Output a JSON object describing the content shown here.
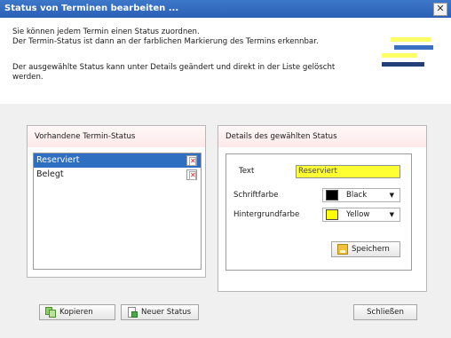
{
  "window": {
    "title": "Status von Terminen bearbeiten ...",
    "close_glyph": "✕"
  },
  "intro": {
    "line1": "Sie können jedem Termin einen Status zuordnen.",
    "line2": "Der Termin-Status ist dann an der farblichen Markierung des Termins erkennbar.",
    "line3": "Der ausgewählte Status kann unter Details geändert und direkt in der Liste gelöscht werden."
  },
  "status_list": {
    "header": "Vorhandene Termin-Status",
    "items": [
      {
        "label": "Reserviert",
        "selected": true
      },
      {
        "label": "Belegt",
        "selected": false
      }
    ],
    "delete_icon": "delete-icon"
  },
  "details": {
    "header": "Details des gewählten Status",
    "text_label": "Text",
    "text_value": "Reserviert",
    "font_color_label": "Schriftfarbe",
    "font_color_value": "Black",
    "font_color_hex": "#000000",
    "bg_color_label": "Hintergrundfarbe",
    "bg_color_value": "Yellow",
    "bg_color_hex": "#ffff00",
    "dropdown_icon": "▼",
    "save_label": "Speichern"
  },
  "footer": {
    "copy_label": "Kopieren",
    "new_label": "Neuer Status",
    "close_label": "Schließen"
  },
  "colors": {
    "titlebar": "#2a60b6",
    "selection": "#2f6fc2",
    "text_field_bg": "#ffff33"
  }
}
